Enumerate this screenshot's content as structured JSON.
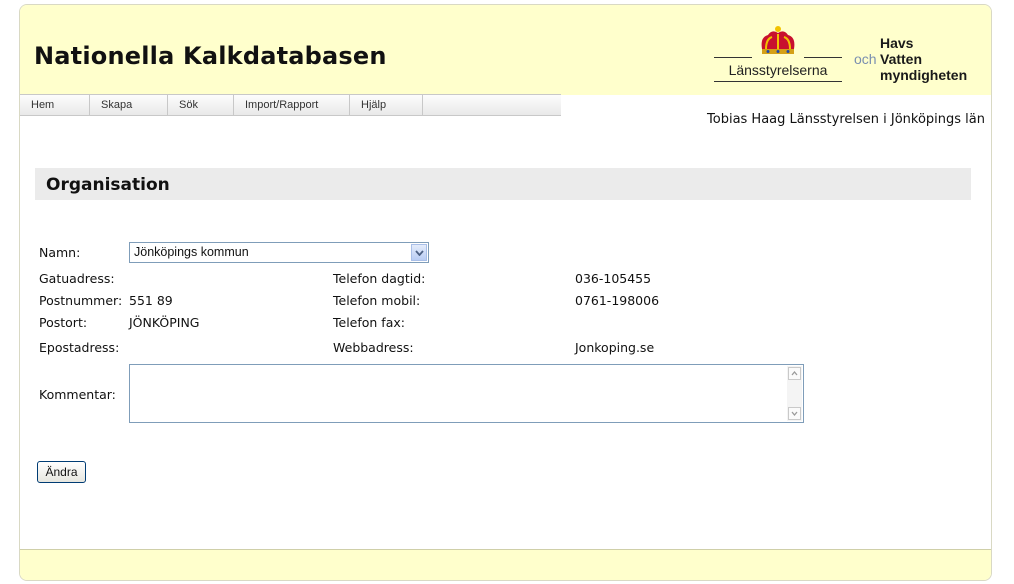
{
  "header": {
    "title": "Nationella Kalkdatabasen",
    "logo_lansstyrelserna": "Länsstyrelserna",
    "logo_hav": {
      "och": "och",
      "line1": "Havs",
      "line2": "Vatten",
      "line3": "myndigheten"
    }
  },
  "nav": {
    "items": [
      {
        "label": "Hem"
      },
      {
        "label": "Skapa"
      },
      {
        "label": "Sök"
      },
      {
        "label": "Import/Rapport"
      },
      {
        "label": "Hjälp"
      },
      {
        "label": ""
      }
    ]
  },
  "user": {
    "line": "Tobias Haag Länsstyrelsen i Jönköpings län"
  },
  "section": {
    "title": "Organisation"
  },
  "form": {
    "namn_label": "Namn:",
    "namn_value": "Jönköpings kommun",
    "gatuadress_label": "Gatuadress:",
    "gatuadress_value": "",
    "postnummer_label": "Postnummer:",
    "postnummer_value": "551 89",
    "postort_label": "Postort:",
    "postort_value": "JÖNKÖPING",
    "epost_label": "Epostadress:",
    "epost_value": "",
    "tel_dag_label": "Telefon dagtid:",
    "tel_dag_value": "036-105455",
    "tel_mobil_label": "Telefon mobil:",
    "tel_mobil_value": "0761-198006",
    "tel_fax_label": "Telefon fax:",
    "tel_fax_value": "",
    "webb_label": "Webbadress:",
    "webb_value": "Jonkoping.se",
    "kommentar_label": "Kommentar:",
    "kommentar_value": "",
    "andra_button": "Ändra"
  },
  "colors": {
    "header_bg": "#ffffcc",
    "section_bg": "#ebebeb",
    "field_border": "#7f9db9"
  }
}
